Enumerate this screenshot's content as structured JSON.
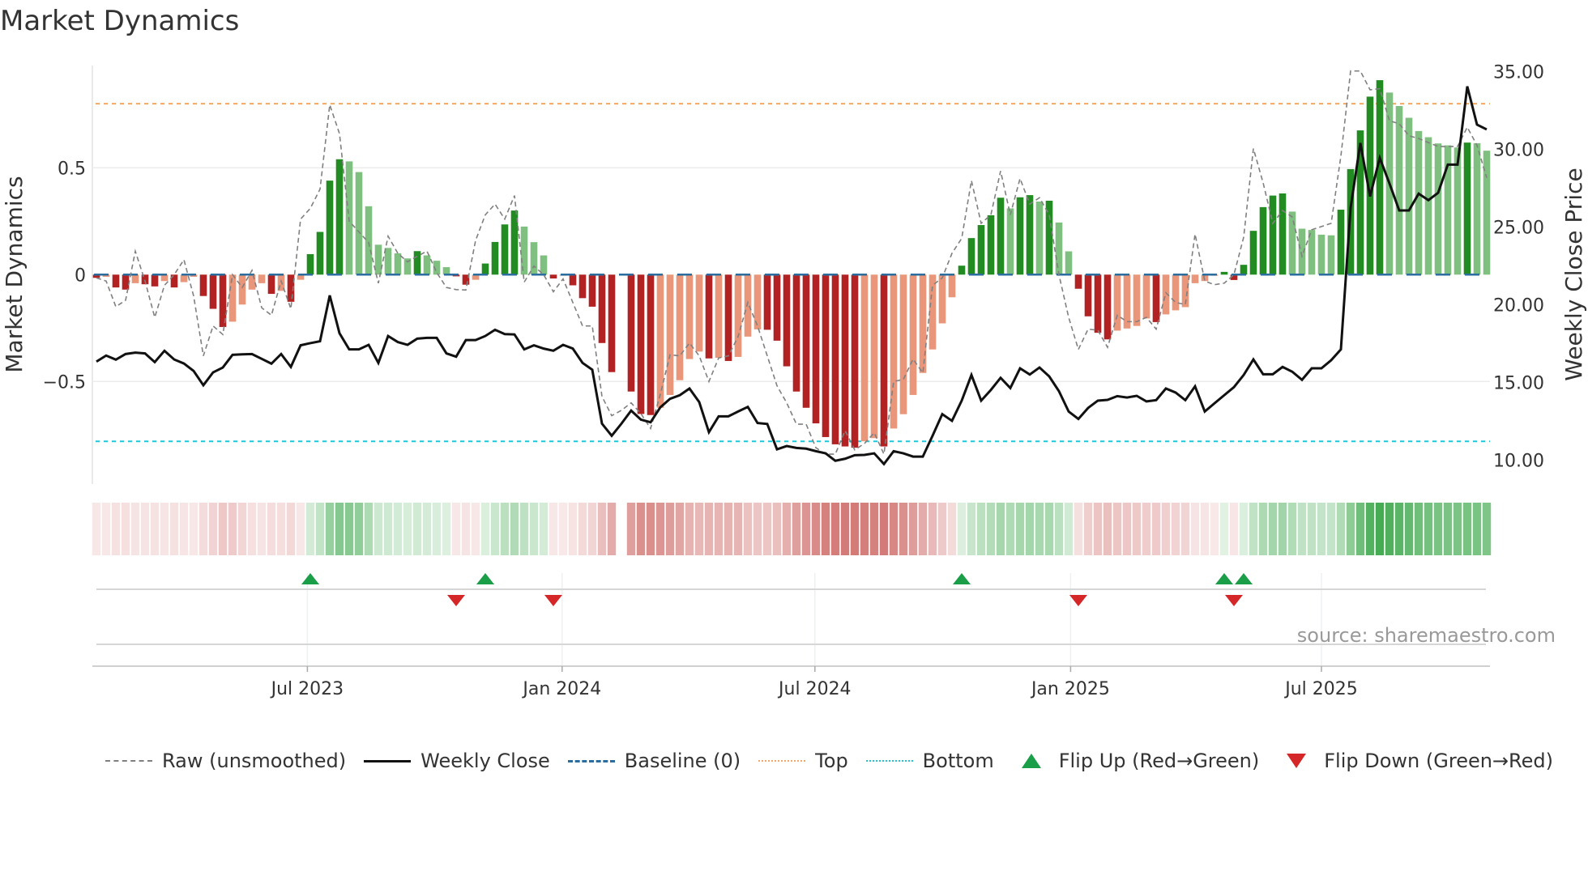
{
  "chart_data": {
    "type": "bar",
    "title": "Market Dynamics",
    "ylabel": "Market Dynamics",
    "y2label": "Weekly Close Price",
    "xlabel": "",
    "ylim": [
      -0.95,
      1.0
    ],
    "y2lim": [
      8.9,
      35.5
    ],
    "y_ticks": [
      {
        "v": 0.5,
        "label": "0.5"
      },
      {
        "v": 0,
        "label": "0"
      },
      {
        "v": -0.5,
        "label": "−0.5"
      }
    ],
    "y2_ticks": [
      {
        "v": 35,
        "label": "35.00"
      },
      {
        "v": 30,
        "label": "30.00"
      },
      {
        "v": 25,
        "label": "25.00"
      },
      {
        "v": 20,
        "label": "20.00"
      },
      {
        "v": 15,
        "label": "15.00"
      },
      {
        "v": 10,
        "label": "10.00"
      }
    ],
    "x_unit": "week index",
    "x_ticks": [
      {
        "week": 21.7,
        "label": "Jul 2023"
      },
      {
        "week": 47.9,
        "label": "Jan 2024"
      },
      {
        "week": 73.9,
        "label": "Jul 2024"
      },
      {
        "week": 100.2,
        "label": "Jan 2025"
      },
      {
        "week": 126.0,
        "label": "Jul 2025"
      }
    ],
    "top_level": 0.8,
    "bottom_level": -0.78,
    "baseline": 0,
    "grid": true,
    "legend_position": "bottom",
    "colors": {
      "pos_strong": "#228b22",
      "pos_weak": "#7fbf7f",
      "neg_strong": "#b22222",
      "neg_weak": "#e9967a",
      "raw": "#808080",
      "close": "#111111",
      "baseline": "#2a6d9e",
      "top": "#f0a868",
      "bottom": "#22c5d8",
      "flip_up": "#1a9e48",
      "flip_down": "#d62728"
    },
    "smoothed": [
      -0.015,
      -0.01,
      -0.06,
      -0.07,
      -0.04,
      -0.045,
      -0.055,
      -0.03,
      -0.06,
      -0.035,
      -0.01,
      -0.1,
      -0.16,
      -0.245,
      -0.22,
      -0.14,
      -0.07,
      -0.04,
      -0.09,
      -0.076,
      -0.127,
      -0.024,
      0.096,
      0.2,
      0.44,
      0.54,
      0.53,
      0.48,
      0.32,
      0.14,
      0.125,
      0.1,
      0.076,
      0.11,
      0.09,
      0.065,
      0.035,
      -0.008,
      -0.047,
      -0.024,
      0.052,
      0.153,
      0.235,
      0.3,
      0.225,
      0.152,
      0.09,
      -0.018,
      -0.005,
      -0.05,
      -0.11,
      -0.15,
      -0.32,
      -0.456,
      null,
      -0.547,
      -0.652,
      -0.657,
      -0.623,
      -0.563,
      -0.494,
      -0.395,
      -0.36,
      -0.392,
      -0.389,
      -0.404,
      -0.385,
      -0.29,
      -0.256,
      -0.258,
      -0.309,
      -0.429,
      -0.547,
      -0.623,
      -0.696,
      -0.76,
      -0.794,
      -0.804,
      -0.81,
      -0.78,
      -0.765,
      -0.804,
      -0.72,
      -0.653,
      -0.563,
      -0.46,
      -0.35,
      -0.228,
      -0.106,
      0.042,
      0.171,
      0.232,
      0.278,
      0.36,
      0.31,
      0.362,
      0.372,
      0.342,
      0.346,
      0.244,
      0.109,
      -0.066,
      -0.195,
      -0.272,
      -0.303,
      -0.262,
      -0.252,
      -0.24,
      -0.205,
      -0.222,
      -0.186,
      -0.167,
      -0.152,
      -0.04,
      -0.03,
      -0.005,
      0.013,
      -0.025,
      0.046,
      0.205,
      0.316,
      0.37,
      0.38,
      0.295,
      0.215,
      0.209,
      0.187,
      0.184,
      0.304,
      0.494,
      0.675,
      0.833,
      0.91,
      0.852,
      0.789,
      0.734,
      0.672,
      0.643,
      0.614,
      0.605,
      0.595,
      0.618,
      0.615,
      0.58
    ],
    "raw": [
      -0.015,
      -0.03,
      -0.15,
      -0.12,
      0.11,
      -0.03,
      -0.2,
      -0.05,
      0.0,
      0.07,
      -0.1,
      -0.38,
      -0.24,
      -0.28,
      0.0,
      -0.06,
      0.02,
      -0.155,
      -0.19,
      -0.03,
      -0.16,
      0.26,
      0.31,
      0.4,
      0.795,
      0.66,
      0.25,
      0.2,
      0.15,
      -0.04,
      0.18,
      0.1,
      0.06,
      0.086,
      0.11,
      0.01,
      -0.06,
      -0.07,
      -0.072,
      0.16,
      0.28,
      0.33,
      0.26,
      0.37,
      -0.035,
      0.04,
      0.0,
      -0.08,
      -0.02,
      -0.13,
      -0.24,
      -0.24,
      -0.57,
      -0.66,
      -0.635,
      -0.6,
      -0.65,
      -0.72,
      -0.56,
      -0.375,
      -0.38,
      -0.32,
      -0.38,
      -0.5,
      -0.39,
      -0.38,
      -0.29,
      -0.13,
      -0.24,
      -0.38,
      -0.52,
      -0.6,
      -0.7,
      -0.7,
      -0.81,
      -0.84,
      -0.84,
      -0.73,
      -0.82,
      -0.79,
      -0.74,
      -0.84,
      -0.5,
      -0.49,
      -0.395,
      -0.46,
      -0.05,
      -0.015,
      0.1,
      0.17,
      0.44,
      0.24,
      0.28,
      0.485,
      0.28,
      0.45,
      0.33,
      0.36,
      0.28,
      0.0,
      -0.2,
      -0.35,
      -0.255,
      -0.26,
      -0.34,
      -0.19,
      -0.22,
      -0.22,
      -0.2,
      -0.255,
      -0.085,
      -0.13,
      -0.14,
      0.19,
      -0.03,
      -0.047,
      -0.04,
      0.0,
      0.175,
      0.59,
      0.43,
      0.24,
      0.3,
      0.27,
      0.086,
      0.21,
      0.225,
      0.24,
      0.555,
      0.953,
      0.953,
      0.865,
      0.87,
      0.72,
      0.706,
      0.65,
      0.637,
      0.618,
      0.6,
      0.6,
      0.6,
      0.69,
      0.605,
      0.453
    ],
    "close": [
      16.34,
      16.73,
      16.47,
      16.83,
      16.92,
      16.87,
      16.31,
      17.04,
      16.48,
      16.22,
      15.74,
      14.82,
      15.65,
      15.96,
      16.78,
      16.81,
      16.83,
      16.52,
      16.21,
      16.83,
      16.0,
      17.39,
      17.53,
      17.65,
      20.6,
      18.17,
      17.13,
      17.13,
      17.42,
      16.26,
      17.99,
      17.6,
      17.42,
      17.82,
      17.87,
      17.87,
      16.87,
      16.66,
      17.73,
      17.73,
      17.99,
      18.39,
      18.11,
      18.09,
      17.13,
      17.39,
      17.18,
      17.04,
      17.42,
      17.18,
      16.26,
      15.82,
      12.35,
      11.57,
      12.35,
      13.19,
      12.61,
      12.44,
      13.4,
      13.95,
      14.18,
      14.61,
      13.74,
      11.8,
      12.82,
      12.82,
      13.13,
      13.43,
      12.39,
      12.33,
      10.7,
      10.91,
      10.79,
      10.74,
      10.58,
      10.44,
      9.96,
      10.09,
      10.32,
      10.34,
      10.44,
      9.75,
      10.58,
      10.44,
      10.23,
      10.23,
      11.57,
      12.96,
      12.53,
      13.83,
      15.48,
      13.83,
      14.52,
      15.3,
      14.64,
      15.91,
      15.51,
      15.96,
      15.39,
      14.44,
      13.13,
      12.65,
      13.36,
      13.83,
      13.88,
      14.12,
      14.03,
      14.14,
      13.78,
      13.86,
      14.61,
      14.35,
      13.86,
      14.75,
      13.13,
      13.66,
      14.18,
      14.7,
      15.48,
      16.48,
      15.53,
      15.53,
      16.0,
      15.69,
      15.17,
      15.91,
      15.91,
      16.43,
      17.13,
      26.24,
      30.41,
      26.97,
      29.45,
      27.8,
      26.07,
      26.07,
      27.15,
      26.73,
      27.2,
      29.02,
      29.02,
      34.05,
      31.59,
      31.28
    ],
    "flips": [
      {
        "week": 22,
        "dir": "up"
      },
      {
        "week": 37,
        "dir": "down"
      },
      {
        "week": 40,
        "dir": "up"
      },
      {
        "week": 47,
        "dir": "down"
      },
      {
        "week": 89,
        "dir": "up"
      },
      {
        "week": 101,
        "dir": "down"
      },
      {
        "week": 116,
        "dir": "up"
      },
      {
        "week": 117,
        "dir": "down"
      },
      {
        "week": 118,
        "dir": "up"
      }
    ],
    "source": "source: sharemaestro.com",
    "legend": [
      {
        "label": "Raw (unsmoothed)"
      },
      {
        "label": "Weekly Close"
      },
      {
        "label": "Baseline (0)"
      },
      {
        "label": "Top"
      },
      {
        "label": "Bottom"
      },
      {
        "label": "Flip Up (Red→Green)"
      },
      {
        "label": "Flip Down (Green→Red)"
      }
    ]
  }
}
